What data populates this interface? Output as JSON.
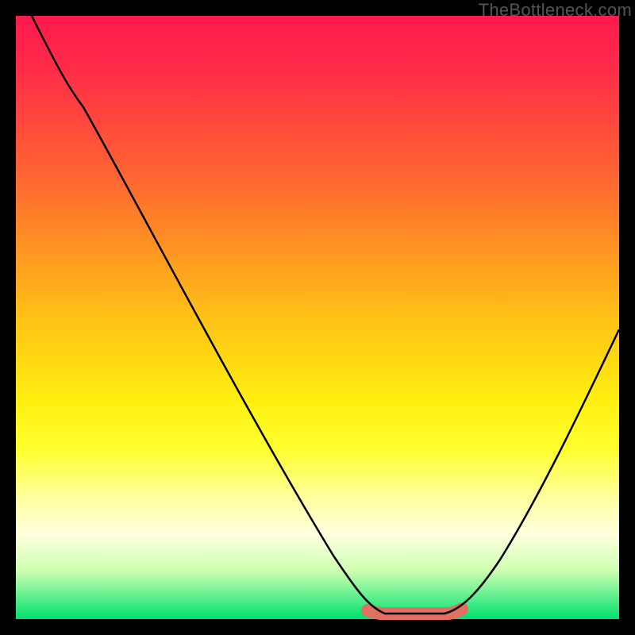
{
  "watermark": "TheBottleneck.com",
  "chart_data": {
    "type": "line",
    "title": "",
    "xlabel": "",
    "ylabel": "",
    "xlim": [
      0,
      100
    ],
    "ylim": [
      0,
      100
    ],
    "x": [
      3,
      10,
      20,
      30,
      40,
      50,
      55,
      58,
      62,
      68,
      72,
      78,
      85,
      92,
      100
    ],
    "values": [
      100,
      88,
      72,
      56,
      40,
      22,
      12,
      5,
      1,
      0,
      0,
      5,
      18,
      35,
      52
    ],
    "series": [
      {
        "name": "bottleneck-curve",
        "x": [
          3,
          10,
          20,
          30,
          40,
          50,
          55,
          58,
          62,
          68,
          72,
          78,
          85,
          92,
          100
        ],
        "values": [
          100,
          88,
          72,
          56,
          40,
          22,
          12,
          5,
          1,
          0,
          0,
          5,
          18,
          35,
          52
        ]
      }
    ],
    "optimum_band": {
      "x_start": 58,
      "x_end": 73,
      "y": 0
    },
    "gradient_stops": [
      {
        "pos": 0.0,
        "color": "#ff1a4d"
      },
      {
        "pos": 0.28,
        "color": "#ff6a30"
      },
      {
        "pos": 0.52,
        "color": "#ffc815"
      },
      {
        "pos": 0.72,
        "color": "#ffff30"
      },
      {
        "pos": 0.92,
        "color": "#ccffb0"
      },
      {
        "pos": 1.0,
        "color": "#00e070"
      }
    ]
  }
}
